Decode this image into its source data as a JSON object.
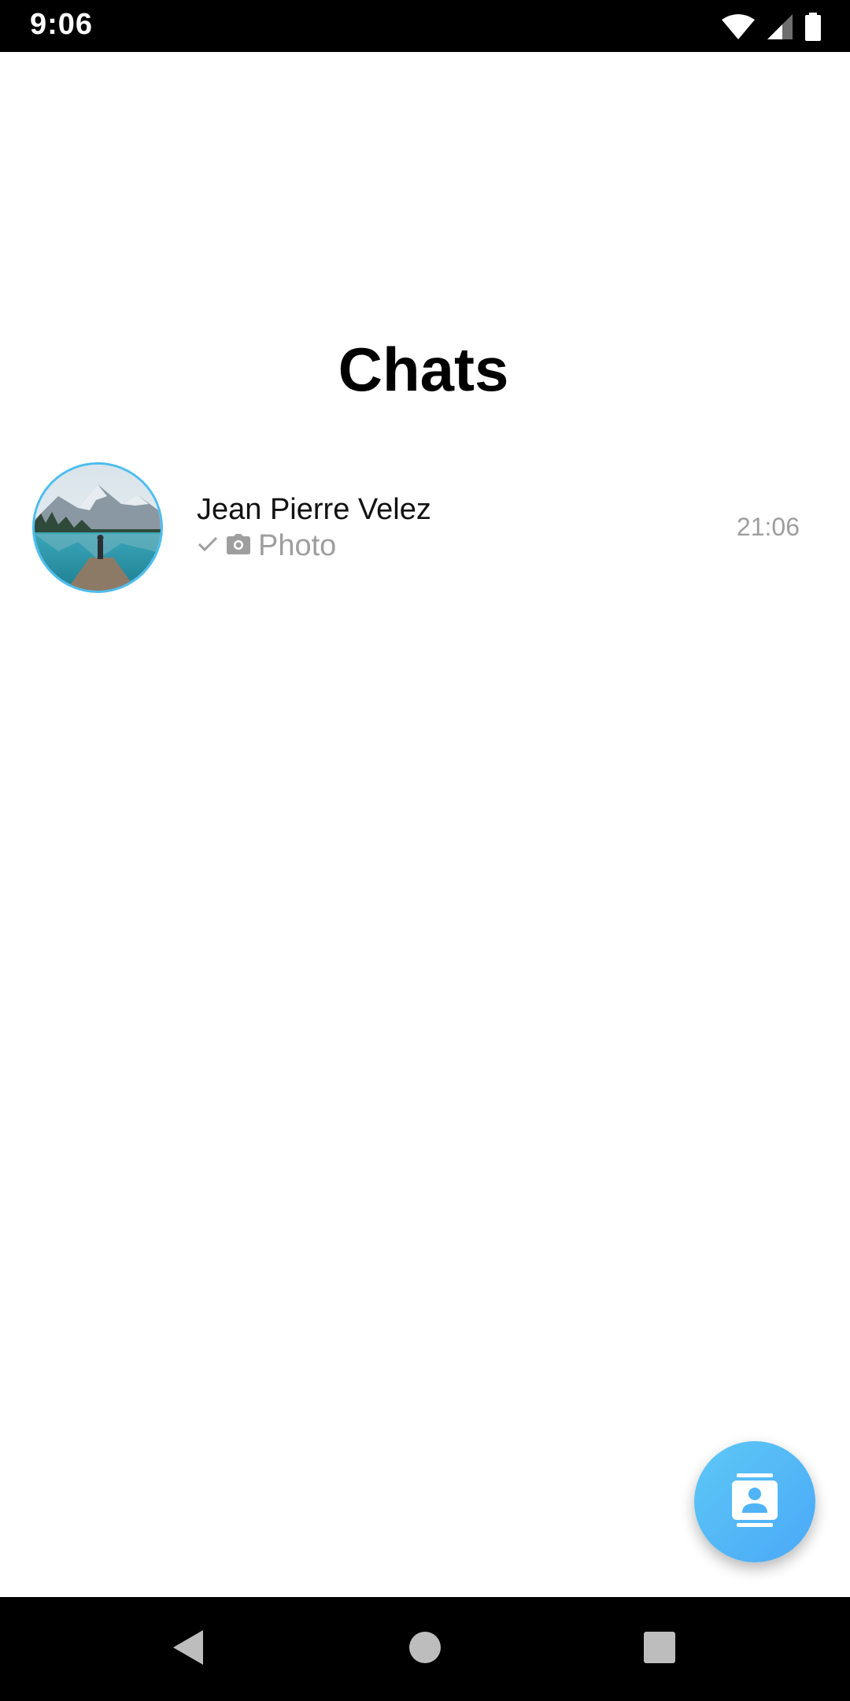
{
  "status_bar": {
    "time": "9:06",
    "icons": [
      "wifi-icon",
      "cellular-signal-icon",
      "battery-icon"
    ]
  },
  "header": {
    "title": "Chats"
  },
  "chats": [
    {
      "name": "Jean Pierre Velez",
      "status_icon": "single-check-icon",
      "attachment_icon": "camera-icon",
      "preview": "Photo",
      "time": "21:06",
      "avatar": "avatar-landscape-lake-mountains"
    }
  ],
  "fab": {
    "icon": "contacts-icon"
  },
  "nav_bar": {
    "buttons": [
      "back-icon",
      "home-icon",
      "recents-icon"
    ]
  },
  "colors": {
    "accent": "#4cbdf0",
    "fab_gradient_start": "#5ec8f6",
    "fab_gradient_end": "#4aa8f7",
    "secondary_text": "#9e9e9e",
    "status_bar_bg": "#000000",
    "nav_bar_bg": "#000000"
  }
}
